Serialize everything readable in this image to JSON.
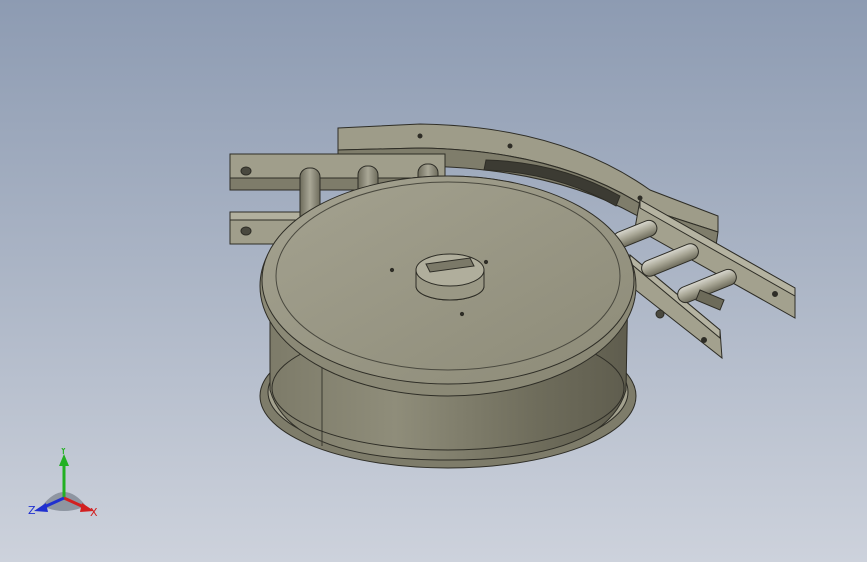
{
  "viewport": {
    "background_top": "#8d9bb2",
    "background_bottom": "#cdd2dc",
    "model_color": "#9c9a86",
    "model_dark": "#6f6d5c",
    "edge_color": "#2e2d26"
  },
  "triad": {
    "x_label": "X",
    "y_label": "Y",
    "z_label": "Z",
    "x_color": "#d22020",
    "y_color": "#22b022",
    "z_color": "#2030d0"
  }
}
